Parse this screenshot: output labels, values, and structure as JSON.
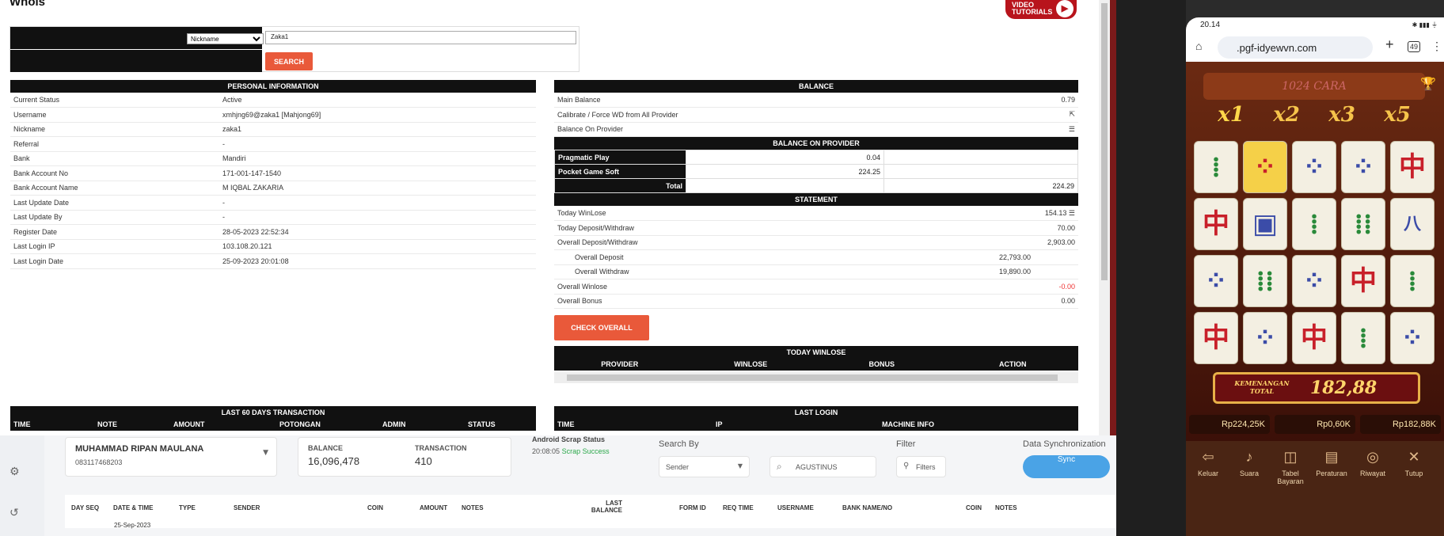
{
  "window": {
    "title": "Whois",
    "video": "VIDEO TUTORIALS"
  },
  "search": {
    "select_value": "Nickname",
    "query": "Zaka1",
    "button": "SEARCH"
  },
  "personal": {
    "header": "PERSONAL INFORMATION",
    "rows": [
      {
        "k": "Current Status",
        "v": "Active"
      },
      {
        "k": "Username",
        "v": "xmhjng69@zaka1  [Mahjong69]"
      },
      {
        "k": "Nickname",
        "v": "zaka1"
      },
      {
        "k": "Referral",
        "v": "-"
      },
      {
        "k": "Bank",
        "v": "Mandiri"
      },
      {
        "k": "Bank Account No",
        "v": "171-001-147-1540"
      },
      {
        "k": "Bank Account Name",
        "v": "M IQBAL ZAKARIA"
      },
      {
        "k": "Last Update Date",
        "v": "-"
      },
      {
        "k": "Last Update By",
        "v": "-"
      },
      {
        "k": "Register Date",
        "v": "28-05-2023 22:52:34"
      },
      {
        "k": "Last Login IP",
        "v": "103.108.20.121"
      },
      {
        "k": "Last Login Date",
        "v": "25-09-2023 20:01:08"
      }
    ]
  },
  "balance": {
    "header": "BALANCE",
    "main_label": "Main Balance",
    "main_value": "0.79",
    "calibrate": "Calibrate / Force WD from All Provider",
    "on_provider": "Balance On Provider",
    "provider_header": "BALANCE ON PROVIDER",
    "providers": [
      {
        "name": "Pragmatic Play",
        "value": "0.04"
      },
      {
        "name": "Pocket Game Soft",
        "value": "224.25"
      }
    ],
    "total_label": "Total",
    "total_value": "224.29"
  },
  "statement": {
    "header": "STATEMENT",
    "today_winlose": "Today WinLose",
    "today_winlose_v": "154.13",
    "today_dw": "Today Deposit/Withdraw",
    "today_dw_v": "70.00",
    "overall_dw": "Overall Deposit/Withdraw",
    "overall_dw_v": "2,903.00",
    "overall_dep": "Overall Deposit",
    "overall_dep_v": "22,793.00",
    "overall_wd": "Overall Withdraw",
    "overall_wd_v": "19,890.00",
    "overall_winlose": "Overall Winlose",
    "overall_winlose_v": "-0.00",
    "overall_bonus": "Overall Bonus",
    "overall_bonus_v": "0.00",
    "check_button": "CHECK OVERALL"
  },
  "today_winlose": {
    "header": "TODAY WINLOSE",
    "cols": [
      "PROVIDER",
      "WINLOSE",
      "BONUS",
      "ACTION"
    ]
  },
  "last60": {
    "header": "LAST 60 DAYS TRANSACTION",
    "cols": [
      "TIME",
      "NOTE",
      "AMOUNT",
      "POTONGAN",
      "ADMIN",
      "STATUS"
    ]
  },
  "last_login": {
    "header": "LAST LOGIN",
    "cols": [
      "TIME",
      "IP",
      "MACHINE INFO"
    ]
  },
  "app": {
    "account_name": "MUHAMMAD RIPAN MAULANA",
    "account_no": "083117468203",
    "balance_label": "BALANCE",
    "balance_value": "16,096,478",
    "trans_label": "TRANSACTION",
    "trans_value": "410",
    "scrap_label": "Android Scrap Status",
    "scrap_time": "20:08:05",
    "scrap_status": "Scrap Success",
    "search_by_label": "Search By",
    "search_by_value": "Sender",
    "search_value": "AGUSTINUS",
    "filter_label": "Filter",
    "filter_button": "Filters",
    "sync_label": "Data Synchronization",
    "sync_button": "Sync",
    "columns": [
      "DAY SEQ",
      "DATE & TIME",
      "TYPE",
      "SENDER",
      "COIN",
      "AMOUNT",
      "NOTES",
      "LAST BALANCE",
      "FORM ID",
      "REQ TIME",
      "USERNAME",
      "BANK NAME/NO",
      "COIN",
      "NOTES"
    ],
    "first_row_date": "25-Sep-2023"
  },
  "phone": {
    "time": "20.14",
    "url": ".pgf-idyewvn.com",
    "tabs": "49",
    "game_title": "1024 CARA",
    "multipliers": [
      "x1",
      "x2",
      "x3",
      "x5"
    ],
    "win_label": "KEMENANGAN TOTAL",
    "win_value": "182,88",
    "chips": [
      "Rp224,25K",
      "Rp0,60K",
      "Rp182,88K"
    ],
    "menu": [
      "Keluar",
      "Suara",
      "Tabel Bayaran",
      "Peraturan",
      "Riwayat",
      "Tutup"
    ]
  }
}
